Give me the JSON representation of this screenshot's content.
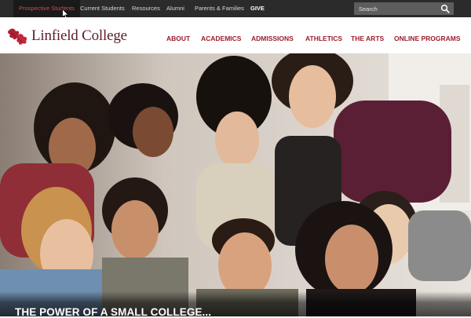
{
  "utility_nav": {
    "items": [
      {
        "label": "Prospective Students",
        "active": true
      },
      {
        "label": "Current Students"
      },
      {
        "label": "Resources"
      },
      {
        "label": "Alumni"
      },
      {
        "label": "Parents & Families"
      },
      {
        "label": "GIVE"
      }
    ],
    "search_placeholder": "Search",
    "search_icon": "magnifier-icon"
  },
  "brand": {
    "name": "Linfield College",
    "logo_icon": "oak-leaves-icon"
  },
  "main_nav": {
    "items": [
      {
        "label": "ABOUT"
      },
      {
        "label": "ACADEMICS"
      },
      {
        "label": "ADMISSIONS"
      },
      {
        "label": "ATHLETICS"
      },
      {
        "label": "THE ARTS"
      },
      {
        "label": "ONLINE PROGRAMS"
      }
    ]
  },
  "hero": {
    "image_subject": "group selfie of smiling students",
    "caption": "THE POWER OF A SMALL COLLEGE..."
  },
  "colors": {
    "utility_bg": "#2b2b2b",
    "active_link": "#d24b4b",
    "brand_maroon": "#5a1d2a",
    "nav_red": "#9b1c2b"
  }
}
